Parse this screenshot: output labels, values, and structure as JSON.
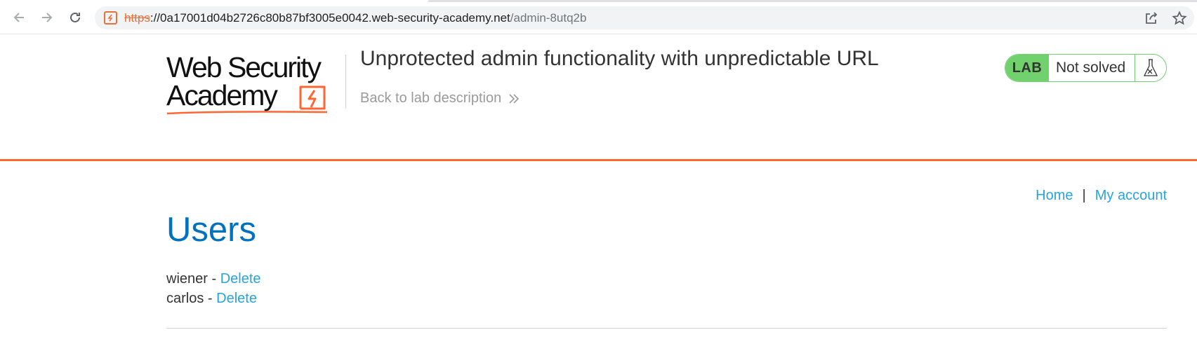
{
  "browser": {
    "url_scheme": "https",
    "url_separator": "://",
    "url_host": "0a17001d04b2726c80b87bf3005e0042.web-security-academy.net",
    "url_path": "/admin-8utq2b",
    "icons": [
      "back-arrow-icon",
      "forward-arrow-icon",
      "reload-icon",
      "not-secure-icon",
      "share-icon",
      "star-icon"
    ]
  },
  "header": {
    "logo_line1": "Web Security",
    "logo_line2": "Academy",
    "lab_title": "Unprotected admin functionality with unpredictable URL",
    "back_link": "Back to lab description",
    "lab_badge": "LAB",
    "lab_status": "Not solved",
    "colors": {
      "accent": "#ff6633",
      "status_green": "#70d16d",
      "link": "#29a3db",
      "heading": "#0071bc"
    }
  },
  "nav": {
    "home": "Home",
    "separator": "|",
    "my_account": "My account"
  },
  "main": {
    "heading": "Users",
    "users": [
      {
        "name": "wiener",
        "sep": " - ",
        "action": "Delete"
      },
      {
        "name": "carlos",
        "sep": " - ",
        "action": "Delete"
      }
    ]
  }
}
